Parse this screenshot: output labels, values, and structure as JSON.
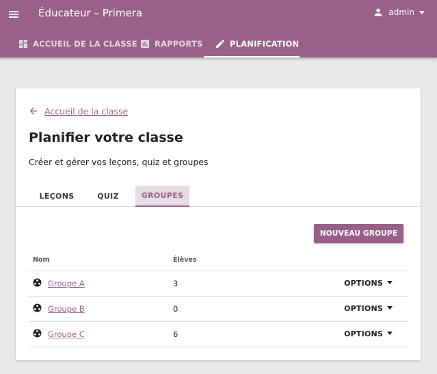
{
  "colors": {
    "brand": "#996189",
    "background": "#e9e9e9",
    "card": "#ffffff",
    "tab_active_bg": "#e6dde4"
  },
  "header": {
    "title": "Éducateur – Primera",
    "user_label": "admin",
    "menu_icon": "hamburger-menu-icon",
    "user_icon": "person-icon"
  },
  "nav_tabs": [
    {
      "label": "ACCUEIL DE LA CLASSE",
      "icon": "dashboard-icon",
      "active": false
    },
    {
      "label": "RAPPORTS",
      "icon": "bar-chart-icon",
      "active": false
    },
    {
      "label": "PLANIFICATION",
      "icon": "pencil-icon",
      "active": true
    }
  ],
  "main": {
    "back_link": "Accueil de la classe",
    "title": "Planifier votre classe",
    "description": "Créer et gérer vos leçons, quiz et groupes",
    "sub_tabs": [
      {
        "label": "LEÇONS",
        "active": false
      },
      {
        "label": "QUIZ",
        "active": false
      },
      {
        "label": "GROUPES",
        "active": true
      }
    ],
    "new_group_button": "NOUVEAU GROUPE",
    "table": {
      "headers": {
        "name": "Nom",
        "students": "Élèves"
      },
      "options_label": "OPTIONS",
      "rows": [
        {
          "name": "Groupe A",
          "students": "3"
        },
        {
          "name": "Groupe B",
          "students": "0"
        },
        {
          "name": "Groupe C",
          "students": "6"
        }
      ]
    }
  }
}
